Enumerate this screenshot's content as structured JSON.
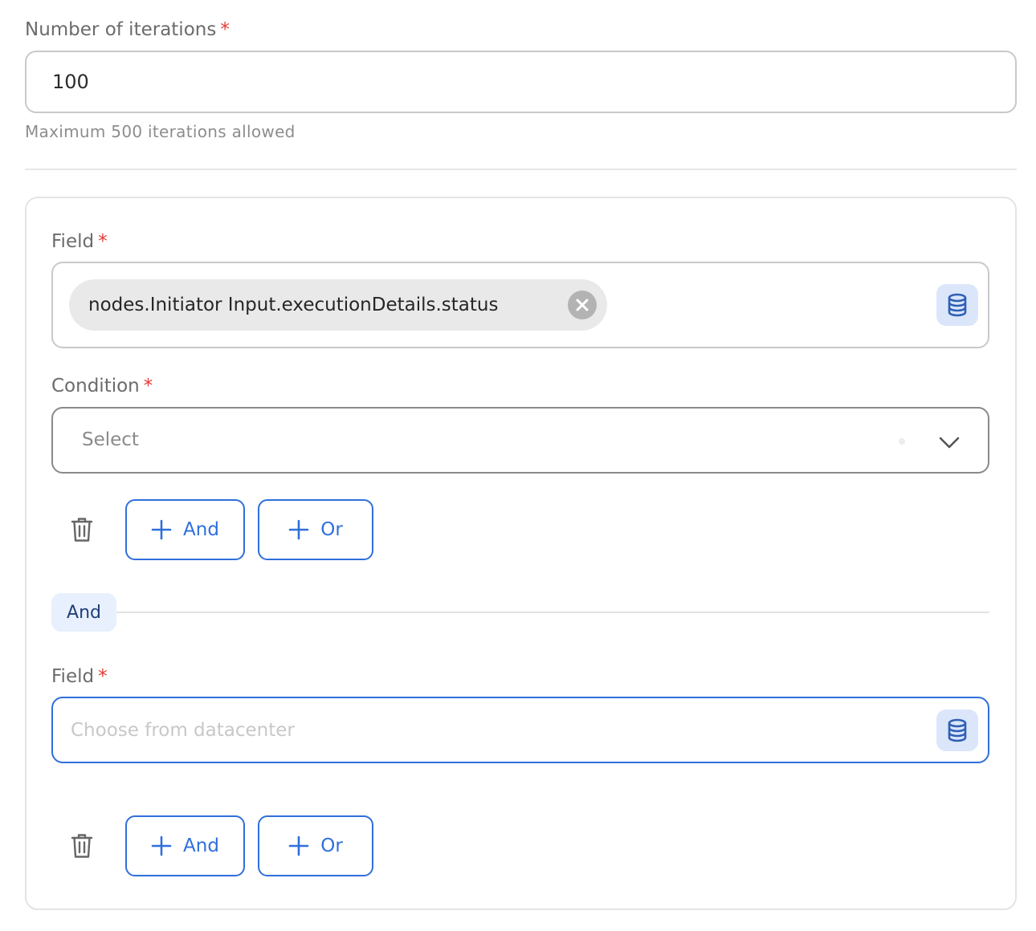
{
  "iterations": {
    "label": "Number of iterations",
    "required_mark": "*",
    "value": "100",
    "help_text": "Maximum 500 iterations allowed"
  },
  "condition_group": {
    "rule_1": {
      "field": {
        "label": "Field",
        "required_mark": "*",
        "chip_value": "nodes.Initiator Input.executionDetails.status",
        "picker_icon": "database-icon"
      },
      "condition": {
        "label": "Condition",
        "required_mark": "*",
        "placeholder": "Select"
      },
      "actions": {
        "delete_icon": "trash-icon",
        "and_label": "And",
        "or_label": "Or"
      }
    },
    "connector": {
      "label": "And"
    },
    "rule_2": {
      "field": {
        "label": "Field",
        "required_mark": "*",
        "placeholder": "Choose from datacenter",
        "picker_icon": "database-icon"
      },
      "actions": {
        "delete_icon": "trash-icon",
        "and_label": "And",
        "or_label": "Or"
      }
    }
  },
  "colors": {
    "accent": "#2f6fdc",
    "required": "#e53935",
    "badge_bg": "#e8f0fd",
    "icon_bg": "#dbe6fb"
  }
}
